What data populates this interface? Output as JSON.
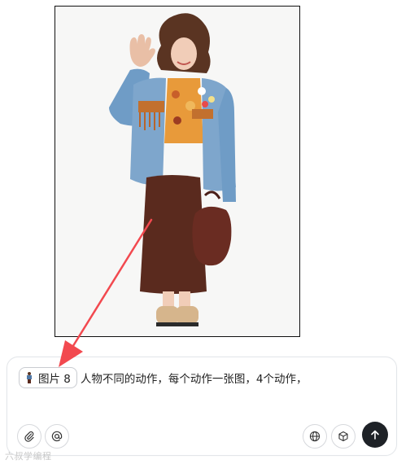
{
  "image": {
    "subject": "woman-in-denim-jacket-waving"
  },
  "composer": {
    "chip_label": "图片 8",
    "prompt_text": "人物不同的动作，每个动作一张图，4个动作，",
    "attach_icon": "paperclip-icon",
    "mention_icon": "at-icon",
    "web_icon": "globe-icon",
    "model_icon": "cube-icon",
    "send_icon": "arrow-up-icon"
  },
  "annotation": {
    "arrow_color": "#f2494f"
  },
  "watermark": {
    "text": "六叔学编程"
  }
}
